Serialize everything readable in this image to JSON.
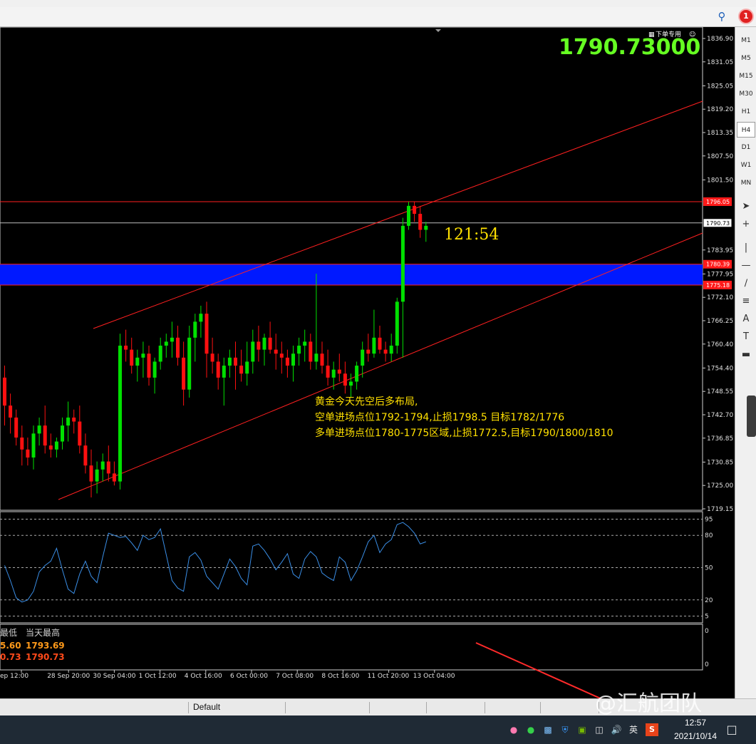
{
  "window": {
    "notification_count": "1"
  },
  "price_big": "1790.73000",
  "trade_menu_label": "下单专用",
  "countdown": "121:54",
  "price_axis": [
    "1836.90",
    "1831.05",
    "1825.05",
    "1819.20",
    "1813.35",
    "1807.50",
    "1801.50",
    "1783.95",
    "1777.95",
    "1772.10",
    "1766.25",
    "1760.40",
    "1754.40",
    "1748.55",
    "1742.70",
    "1736.85",
    "1730.85",
    "1725.00",
    "1719.15"
  ],
  "price_tags": {
    "resistance": "1796.05",
    "current": "1790.73",
    "zone_top": "1780.39",
    "zone_bottom": "1775.18"
  },
  "rsi_axis": [
    "95",
    "80",
    "50",
    "20",
    "5"
  ],
  "sub_axis": [
    "0",
    "0"
  ],
  "annotation": {
    "line1": "黄金今天先空后多布局,",
    "line2": "空单进场点位1792-1794,止损1798.5 目标1782/1776",
    "line3": "多单进场点位1780-1775区域,止损1772.5,目标1790/1800/1810"
  },
  "stats": {
    "low_label": "最低",
    "high_label": "当天最高",
    "low_val": "5.60",
    "high_val": "1793.69",
    "cur_low": "0.73",
    "cur_high": "1790.73"
  },
  "time_axis": [
    "ep 12:00",
    "28 Sep 20:00",
    "30 Sep 04:00",
    "1 Oct 12:00",
    "4 Oct 16:00",
    "6 Oct 00:00",
    "7 Oct 08:00",
    "8 Oct 16:00",
    "11 Oct 20:00",
    "13 Oct 04:00"
  ],
  "timeframes": [
    "M1",
    "M5",
    "M15",
    "M30",
    "H1",
    "H4",
    "D1",
    "W1",
    "MN"
  ],
  "active_timeframe": "H4",
  "tab_label": "Default",
  "watermark": "@汇航团队",
  "taskbar": {
    "time": "12:57",
    "date": "2021/10/14",
    "ime": "英",
    "sogou": "S"
  },
  "colors": {
    "bull": "#00e000",
    "bear": "#ff1010",
    "zone": "#0019ff",
    "channel": "#ff2020",
    "rsi": "#3a8ee6",
    "big_price": "#66ff22",
    "annotation": "#ffe000"
  },
  "chart_data": {
    "type": "candlestick",
    "price_range": [
      1719.15,
      1836.9
    ],
    "candles": [
      [
        1752,
        1755,
        1740,
        1745
      ],
      [
        1745,
        1748,
        1738,
        1742
      ],
      [
        1742,
        1744,
        1735,
        1737
      ],
      [
        1737,
        1740,
        1730,
        1734
      ],
      [
        1734,
        1737,
        1730,
        1732
      ],
      [
        1732,
        1740,
        1729,
        1738
      ],
      [
        1738,
        1742,
        1735,
        1740
      ],
      [
        1740,
        1745,
        1733,
        1735
      ],
      [
        1735,
        1738,
        1732,
        1734
      ],
      [
        1734,
        1737,
        1732,
        1736
      ],
      [
        1736,
        1742,
        1734,
        1740
      ],
      [
        1740,
        1746,
        1736,
        1742
      ],
      [
        1742,
        1744,
        1738,
        1741
      ],
      [
        1741,
        1745,
        1733,
        1735
      ],
      [
        1735,
        1738,
        1728,
        1730
      ],
      [
        1730,
        1734,
        1722,
        1726
      ],
      [
        1726,
        1731,
        1723,
        1729
      ],
      [
        1729,
        1733,
        1726,
        1731
      ],
      [
        1731,
        1735,
        1726,
        1728
      ],
      [
        1728,
        1731,
        1725,
        1726
      ],
      [
        1726,
        1763,
        1724,
        1760
      ],
      [
        1760,
        1764,
        1756,
        1759
      ],
      [
        1759,
        1762,
        1753,
        1755
      ],
      [
        1755,
        1759,
        1751,
        1757
      ],
      [
        1757,
        1761,
        1752,
        1758
      ],
      [
        1758,
        1760,
        1750,
        1752
      ],
      [
        1752,
        1757,
        1748,
        1756
      ],
      [
        1756,
        1762,
        1754,
        1760
      ],
      [
        1760,
        1763,
        1757,
        1761
      ],
      [
        1761,
        1766,
        1757,
        1762
      ],
      [
        1762,
        1765,
        1755,
        1757
      ],
      [
        1757,
        1761,
        1745,
        1749
      ],
      [
        1749,
        1765,
        1747,
        1762
      ],
      [
        1762,
        1768,
        1756,
        1766
      ],
      [
        1766,
        1770,
        1762,
        1768
      ],
      [
        1768,
        1771,
        1752,
        1758
      ],
      [
        1758,
        1762,
        1753,
        1756
      ],
      [
        1756,
        1758,
        1749,
        1752
      ],
      [
        1752,
        1757,
        1745,
        1755
      ],
      [
        1755,
        1759,
        1752,
        1757
      ],
      [
        1757,
        1761,
        1749,
        1755
      ],
      [
        1755,
        1759,
        1751,
        1753
      ],
      [
        1753,
        1761,
        1750,
        1756
      ],
      [
        1756,
        1764,
        1753,
        1761
      ],
      [
        1761,
        1765,
        1756,
        1759
      ],
      [
        1759,
        1763,
        1755,
        1762
      ],
      [
        1762,
        1766,
        1758,
        1759
      ],
      [
        1759,
        1763,
        1754,
        1758
      ],
      [
        1758,
        1761,
        1753,
        1757
      ],
      [
        1757,
        1759,
        1752,
        1755
      ],
      [
        1755,
        1760,
        1751,
        1758
      ],
      [
        1758,
        1762,
        1755,
        1760
      ],
      [
        1760,
        1764,
        1756,
        1761
      ],
      [
        1761,
        1763,
        1754,
        1756
      ],
      [
        1756,
        1778,
        1754,
        1758
      ],
      [
        1758,
        1761,
        1753,
        1755
      ],
      [
        1755,
        1759,
        1750,
        1752
      ],
      [
        1752,
        1756,
        1749,
        1754
      ],
      [
        1754,
        1758,
        1751,
        1753
      ],
      [
        1753,
        1756,
        1748,
        1750
      ],
      [
        1750,
        1753,
        1747,
        1751
      ],
      [
        1751,
        1756,
        1749,
        1755
      ],
      [
        1755,
        1761,
        1752,
        1759
      ],
      [
        1759,
        1763,
        1756,
        1758
      ],
      [
        1758,
        1769,
        1757,
        1762
      ],
      [
        1762,
        1765,
        1758,
        1759
      ],
      [
        1759,
        1761,
        1756,
        1758
      ],
      [
        1758,
        1763,
        1756,
        1760
      ],
      [
        1760,
        1772,
        1758,
        1771
      ],
      [
        1771,
        1792,
        1757,
        1790
      ],
      [
        1790,
        1796,
        1789,
        1795
      ],
      [
        1795,
        1796,
        1791,
        1793
      ],
      [
        1793,
        1795,
        1787,
        1789
      ],
      [
        1789,
        1791,
        1786,
        1790
      ]
    ],
    "horizontal_lines": [
      1796.05,
      1790.73
    ],
    "zone": [
      1775.18,
      1780.39
    ],
    "rsi_levels": [
      95,
      80,
      50,
      20,
      5
    ],
    "rsi": [
      52,
      38,
      22,
      18,
      20,
      28,
      46,
      52,
      56,
      68,
      48,
      30,
      26,
      44,
      56,
      42,
      36,
      60,
      82,
      80,
      78,
      79,
      73,
      66,
      80,
      76,
      78,
      86,
      62,
      38,
      31,
      28,
      60,
      64,
      57,
      42,
      36,
      30,
      44,
      58,
      51,
      40,
      34,
      70,
      72,
      66,
      58,
      48,
      55,
      63,
      44,
      40,
      58,
      65,
      60,
      45,
      41,
      38,
      60,
      55,
      38,
      47,
      60,
      74,
      80,
      64,
      72,
      76,
      90,
      92,
      88,
      82,
      72,
      74
    ]
  }
}
